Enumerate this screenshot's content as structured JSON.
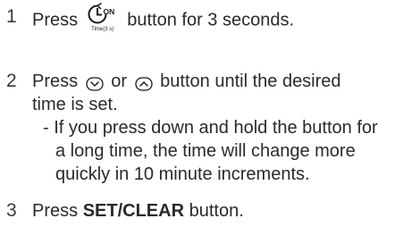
{
  "steps": [
    {
      "number": "1",
      "before_icon": "Press",
      "icon": "timer-on-icon",
      "icon_text": "ON",
      "icon_caption": "Time(3 s)",
      "after_icon": "button for 3 seconds."
    },
    {
      "number": "2",
      "line1_press": "Press",
      "down_icon": "chevron-down-button-icon",
      "line1_or": "or",
      "up_icon": "chevron-up-button-icon",
      "line1_after": "button until the desired",
      "line2": "time is set.",
      "note_line1": "- If you press down and hold the button for",
      "note_line2": "a long time, the time will change more",
      "note_line3": "quickly in 10 minute increments."
    },
    {
      "number": "3",
      "before_bold": "Press",
      "bold": "SET/CLEAR",
      "after_bold": "button."
    }
  ],
  "colors": {
    "text": "#2a2a2a",
    "icon": "#1a1a1a"
  }
}
